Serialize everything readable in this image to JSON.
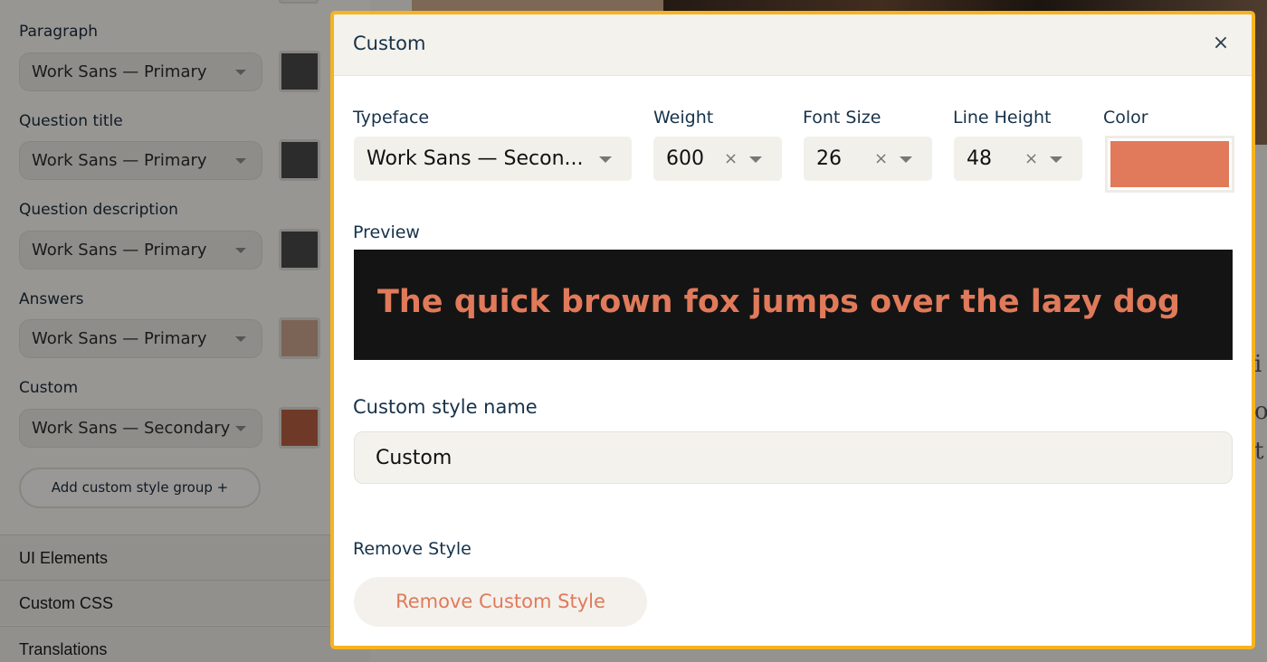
{
  "sidebar": {
    "groups": [
      {
        "label": "Paragraph",
        "font": "Work Sans — Primary",
        "color": "#484848"
      },
      {
        "label": "Question title",
        "font": "Work Sans — Primary",
        "color": "#484848"
      },
      {
        "label": "Question description",
        "font": "Work Sans — Primary",
        "color": "#484848"
      },
      {
        "label": "Answers",
        "font": "Work Sans — Primary",
        "color": "#c7a08a"
      },
      {
        "label": "Custom",
        "font": "Work Sans — Secondary",
        "color": "#b45c42"
      }
    ],
    "add_group_label": "Add custom style group +",
    "sections": [
      "UI Elements",
      "Custom CSS",
      "Translations"
    ]
  },
  "background": {
    "letters": [
      "i",
      "o",
      "t"
    ]
  },
  "modal": {
    "title": "Custom",
    "close_label": "×",
    "typeface": {
      "label": "Typeface",
      "value": "Work Sans — Secon..."
    },
    "weight": {
      "label": "Weight",
      "value": "600"
    },
    "font_size": {
      "label": "Font Size",
      "value": "26"
    },
    "line_height": {
      "label": "Line Height",
      "value": "48"
    },
    "color": {
      "label": "Color",
      "value": "#e07a5a"
    },
    "clear_glyph": "×",
    "preview": {
      "label": "Preview",
      "text": "The quick brown fox jumps over the lazy dog",
      "background": "#141414",
      "text_color": "#e07a5a"
    },
    "style_name": {
      "label": "Custom style name",
      "value": "Custom"
    },
    "remove": {
      "label": "Remove Style",
      "button": "Remove Custom Style",
      "button_color": "#e07a5a"
    }
  }
}
